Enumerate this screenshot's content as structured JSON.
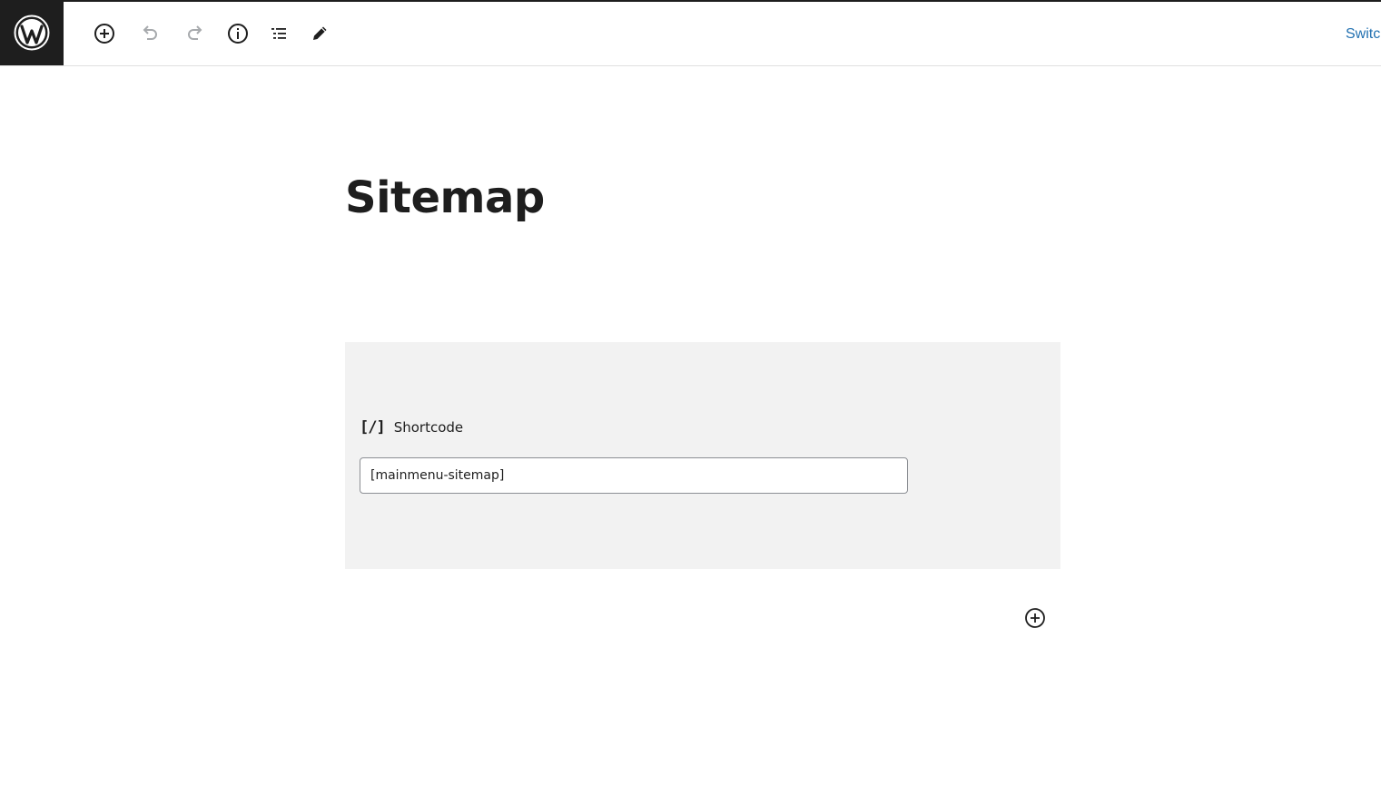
{
  "header": {
    "logo": "wordpress-logo",
    "toolbar": [
      {
        "name": "add-block",
        "icon": "plus-circle-icon"
      },
      {
        "name": "undo",
        "icon": "undo-icon"
      },
      {
        "name": "redo",
        "icon": "redo-icon"
      },
      {
        "name": "details",
        "icon": "info-icon"
      },
      {
        "name": "list-view",
        "icon": "list-view-icon"
      },
      {
        "name": "tools",
        "icon": "pencil-icon"
      }
    ],
    "switch_label": "Switc"
  },
  "editor": {
    "title": "Sitemap",
    "shortcode_block": {
      "icon_text": "[/]",
      "label": "Shortcode",
      "value": "[mainmenu-sitemap]"
    }
  },
  "colors": {
    "dark": "#1e1e1e",
    "link": "#2271b1",
    "block_bg": "#f2f2f2",
    "disabled": "#a7aaad"
  }
}
